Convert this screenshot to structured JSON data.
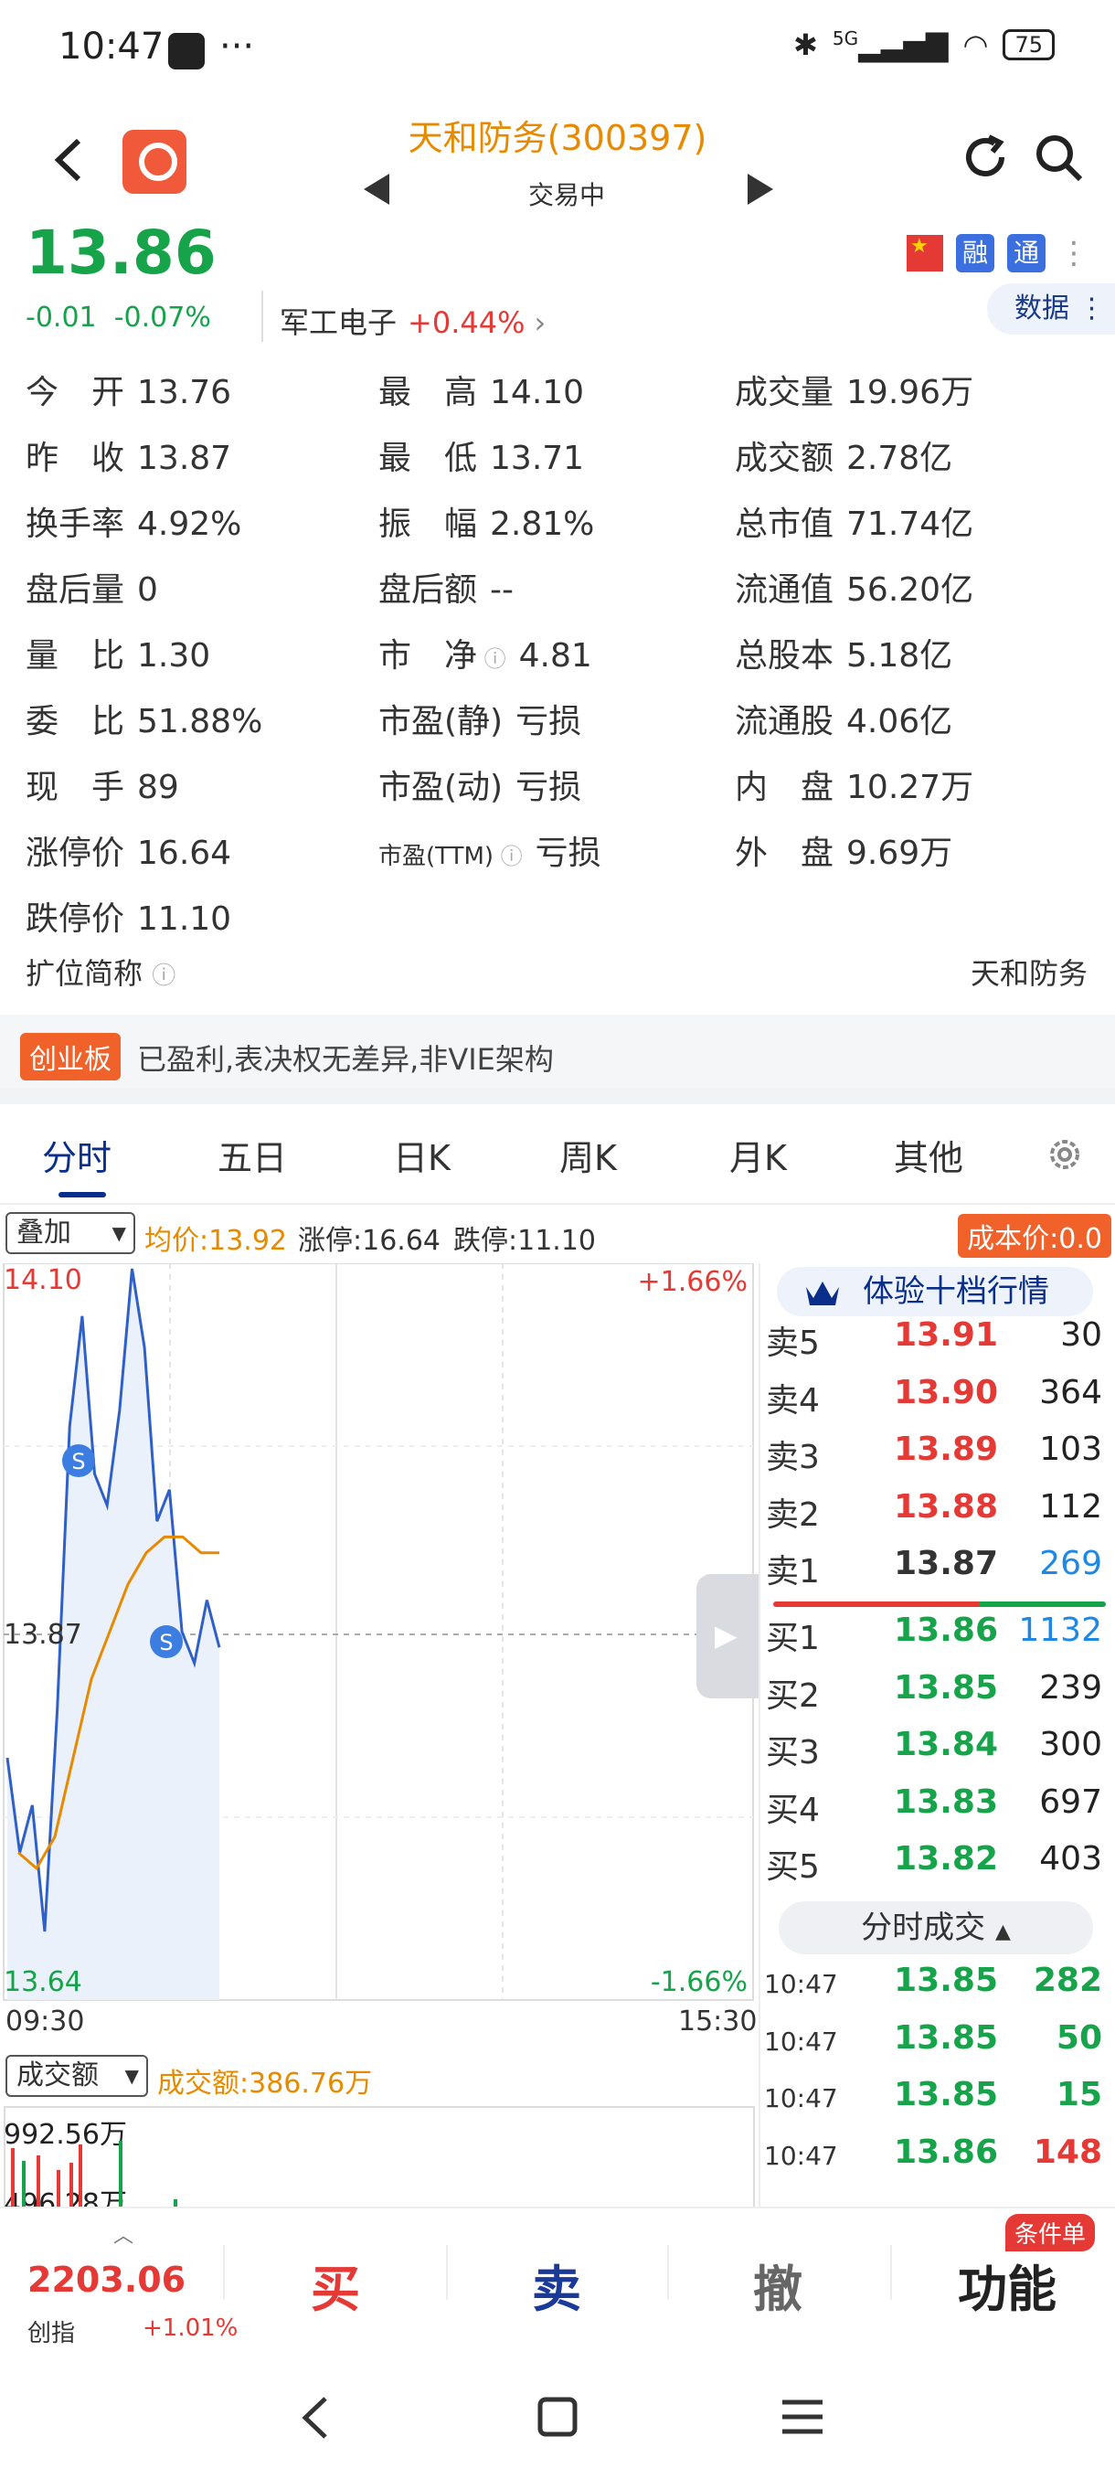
{
  "status_bar": {
    "time": "10:47",
    "more": "···",
    "network": "5G",
    "battery": "75"
  },
  "header": {
    "title": "天和防务(300397)",
    "state": "交易中"
  },
  "quote": {
    "price": "13.86",
    "change": "-0.01",
    "pct": "-0.07%",
    "sector": "军工电子",
    "sector_pct": "+0.44%"
  },
  "badges": {
    "rong": "融",
    "tong": "通",
    "data_btn": "数据"
  },
  "stats": [
    {
      "label": "今　开",
      "value": "13.76"
    },
    {
      "label": "最　高",
      "value": "14.10"
    },
    {
      "label": "成交量",
      "value": "19.96万"
    },
    {
      "label": "昨　收",
      "value": "13.87"
    },
    {
      "label": "最　低",
      "value": "13.71"
    },
    {
      "label": "成交额",
      "value": "2.78亿"
    },
    {
      "label": "换手率",
      "value": "4.92%"
    },
    {
      "label": "振　幅",
      "value": "2.81%"
    },
    {
      "label": "总市值",
      "value": "71.74亿"
    },
    {
      "label": "盘后量",
      "value": "0"
    },
    {
      "label": "盘后额",
      "value": "--"
    },
    {
      "label": "流通值",
      "value": "56.20亿"
    },
    {
      "label": "量　比",
      "value": "1.30"
    },
    {
      "label": "市　净",
      "value": "4.81"
    },
    {
      "label": "总股本",
      "value": "5.18亿"
    },
    {
      "label": "委　比",
      "value": "51.88%"
    },
    {
      "label": "市盈(静)",
      "value": "亏损"
    },
    {
      "label": "流通股",
      "value": "4.06亿"
    },
    {
      "label": "现　手",
      "value": "89"
    },
    {
      "label": "市盈(动)",
      "value": "亏损"
    },
    {
      "label": "内　盘",
      "value": "10.27万"
    },
    {
      "label": "涨停价",
      "value": "16.64"
    },
    {
      "label": "市盈(TTM)",
      "value": "亏损"
    },
    {
      "label": "外　盘",
      "value": "9.69万"
    },
    {
      "label": "跌停价",
      "value": "11.10"
    }
  ],
  "ext": {
    "label": "扩位简称",
    "value": "天和防务"
  },
  "board": {
    "tag": "创业板",
    "desc": "已盈利,表决权无差异,非VIE架构"
  },
  "tabs": [
    "分时",
    "五日",
    "日K",
    "周K",
    "月K",
    "其他"
  ],
  "chart_info": {
    "overlay": "叠加",
    "avg": "均价:13.92",
    "up_limit": "涨停:16.64",
    "down_limit": "跌停:11.10",
    "cost": "成本价:0.0"
  },
  "chart_labels": {
    "high": "14.10",
    "mid": "13.87",
    "low": "13.64",
    "pct_high": "+1.66%",
    "pct_low": "-1.66%",
    "t_open": "09:30",
    "t_close": "15:30",
    "s_marker": "S"
  },
  "chart_data": {
    "type": "line",
    "series": [
      {
        "values": [
          13.79,
          13.73,
          13.76,
          13.68,
          13.82,
          14.0,
          14.07,
          13.97,
          13.95,
          14.01,
          14.1,
          14.05,
          13.94,
          13.96,
          13.87,
          13.85,
          13.89,
          13.86
        ]
      },
      {
        "values": [
          13.73,
          13.72,
          13.74,
          13.79,
          13.84,
          13.87,
          13.9,
          13.92,
          13.93,
          13.93,
          13.92,
          13.92
        ]
      }
    ],
    "ylim": [
      13.64,
      14.1
    ],
    "color_price": "#2f5fc8",
    "color_avg": "#e88a00"
  },
  "depth": {
    "title": "体验十档行情",
    "asks": [
      {
        "k": "卖5",
        "p": "13.91",
        "q": "30"
      },
      {
        "k": "卖4",
        "p": "13.90",
        "q": "364"
      },
      {
        "k": "卖3",
        "p": "13.89",
        "q": "103"
      },
      {
        "k": "卖2",
        "p": "13.88",
        "q": "112"
      },
      {
        "k": "卖1",
        "p": "13.87",
        "q": "269"
      }
    ],
    "bids": [
      {
        "k": "买1",
        "p": "13.86",
        "q": "1132"
      },
      {
        "k": "买2",
        "p": "13.85",
        "q": "239"
      },
      {
        "k": "买3",
        "p": "13.84",
        "q": "300"
      },
      {
        "k": "买4",
        "p": "13.83",
        "q": "697"
      },
      {
        "k": "买5",
        "p": "13.82",
        "q": "403"
      }
    ],
    "ticks_btn": "分时成交",
    "ticks": [
      {
        "t": "10:47",
        "p": "13.85",
        "q": "282"
      },
      {
        "t": "10:47",
        "p": "13.85",
        "q": "50"
      },
      {
        "t": "10:47",
        "p": "13.85",
        "q": "15"
      },
      {
        "t": "10:47",
        "p": "13.86",
        "q": "148"
      }
    ]
  },
  "volume": {
    "selector": "成交额",
    "amount": "成交额:386.76万",
    "max": "992.56万",
    "low_cut": "496.28万"
  },
  "bottom_bar": {
    "index_value": "2203.06",
    "index_name": "创指",
    "index_pct": "+1.01%",
    "buy": "买",
    "sell": "卖",
    "cancel": "撤",
    "func": "功能",
    "order_tag": "条件单"
  },
  "colors": {
    "up": "#e53935",
    "down": "#16a34a",
    "brand": "#0a2f8a",
    "accent": "#e88a00"
  }
}
